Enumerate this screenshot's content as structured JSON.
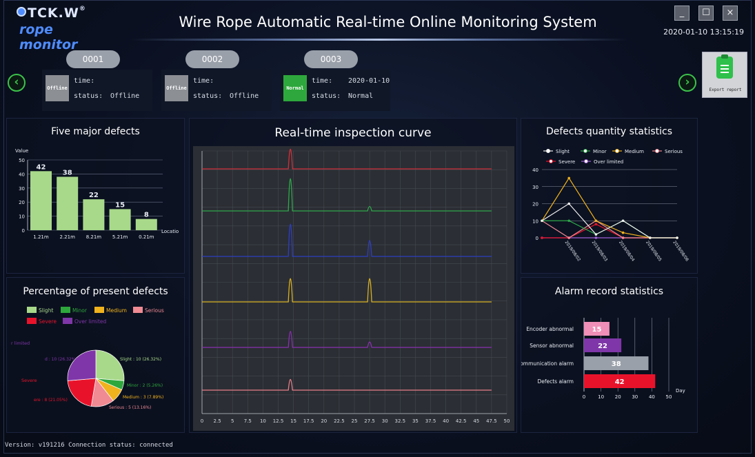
{
  "header": {
    "logo_brand": "TCK.W",
    "logo_sub": "rope monitor",
    "title": "Wire Rope Automatic Real-time Online Monitoring System",
    "datetime": "2020-01-10 13:15:19",
    "min_label": "_",
    "max_label": "☐",
    "close_label": "×"
  },
  "nav": {
    "prev": "‹",
    "next": "›"
  },
  "devices": [
    {
      "id": "0001",
      "status_box": "Offline",
      "status_color": "#8c8f94",
      "time_label": "time:",
      "time_value": "",
      "status_label": "status:",
      "status_value": "Offline"
    },
    {
      "id": "0002",
      "status_box": "Offline",
      "status_color": "#8c8f94",
      "time_label": "time:",
      "time_value": "",
      "status_label": "status:",
      "status_value": "Offline"
    },
    {
      "id": "0003",
      "status_box": "Normal",
      "status_color": "#2ea83c",
      "time_label": "time:",
      "time_value": "2020-01-10",
      "status_label": "status:",
      "status_value": "Normal"
    }
  ],
  "export_label": "Export report",
  "status_bar": "Version: v191216 Connection status: connected",
  "chart_data": [
    {
      "type": "bar",
      "title": "Five major defects",
      "ylabel": "Value",
      "xlabel": "Locatio",
      "categories": [
        "1.21m",
        "2.21m",
        "8.21m",
        "5.21m",
        "0.21m"
      ],
      "values": [
        42,
        38,
        22,
        15,
        8
      ],
      "ylim": [
        0,
        50
      ],
      "yticks": [
        0,
        10,
        20,
        30,
        40,
        50
      ],
      "color": "#a8d98a"
    },
    {
      "type": "pie",
      "title": "Percentage of present defects",
      "legend": [
        {
          "name": "Slight",
          "color": "#a8d98a"
        },
        {
          "name": "Minor",
          "color": "#2ea83c"
        },
        {
          "name": "Medium",
          "color": "#f0b21d"
        },
        {
          "name": "Serious",
          "color": "#f08a93"
        },
        {
          "name": "Severe",
          "color": "#e8132b"
        },
        {
          "name": "Over limited",
          "color": "#7f36a8"
        }
      ],
      "slices": [
        {
          "name": "Slight",
          "value": 10,
          "label": "Slight : 10 (26.32%)"
        },
        {
          "name": "Minor",
          "value": 2,
          "label": "Minor : 2 (5.26%)"
        },
        {
          "name": "Medium",
          "value": 3,
          "label": "Medium : 3 (7.89%)"
        },
        {
          "name": "Serious",
          "value": 5,
          "label": "Serious : 5 (13.16%)"
        },
        {
          "name": "Severe",
          "value": 8,
          "label": "ere : 8 (21.05%)"
        },
        {
          "name": "Over limited",
          "value": 10,
          "label": "d : 10 (26.32%)"
        }
      ],
      "cropped_labels": {
        "over_limited": "r limited",
        "severe": "Severe"
      }
    },
    {
      "type": "line",
      "title": "Real-time inspection curve",
      "xlim": [
        0,
        50
      ],
      "xticks": [
        0,
        2.5,
        5,
        7.5,
        10,
        12.5,
        15,
        17.5,
        20,
        22.5,
        25,
        27.5,
        30,
        32.5,
        35,
        37.5,
        40,
        42.5,
        45,
        47.5,
        50
      ],
      "series": [
        {
          "color": "#d0303a",
          "peaks": [
            {
              "x": 14.5,
              "h": 22
            }
          ]
        },
        {
          "color": "#2ea84a",
          "peaks": [
            {
              "x": 14.5,
              "h": 36
            },
            {
              "x": 27.5,
              "h": 5
            }
          ]
        },
        {
          "color": "#2e3ec2",
          "peaks": [
            {
              "x": 14.5,
              "h": 36
            },
            {
              "x": 27.5,
              "h": 18
            }
          ]
        },
        {
          "color": "#d8b020",
          "peaks": [
            {
              "x": 14.5,
              "h": 26
            },
            {
              "x": 27.5,
              "h": 26
            }
          ]
        },
        {
          "color": "#8a2fb0",
          "peaks": [
            {
              "x": 14.5,
              "h": 18
            },
            {
              "x": 27.5,
              "h": 6
            }
          ]
        },
        {
          "color": "#e87f8a",
          "peaks": [
            {
              "x": 14.5,
              "h": 12
            }
          ]
        }
      ]
    },
    {
      "type": "line",
      "title": "Defects quantity statistics",
      "categories": [
        "2019/08/02",
        "2019/08/03",
        "2019/08/04",
        "2019/08/05",
        "2019/08/06"
      ],
      "ylim": [
        0,
        40
      ],
      "yticks": [
        0,
        10,
        20,
        30,
        40
      ],
      "series": [
        {
          "name": "Slight",
          "color": "#f0f0f0",
          "values": [
            10,
            20,
            2,
            10,
            0,
            0
          ]
        },
        {
          "name": "Minor",
          "color": "#2ea84a",
          "values": [
            10,
            10,
            2,
            10,
            0,
            0
          ]
        },
        {
          "name": "Medium",
          "color": "#f0b21d",
          "values": [
            10,
            35,
            10,
            3,
            0,
            0
          ]
        },
        {
          "name": "Serious",
          "color": "#f08a93",
          "values": [
            10,
            0,
            10,
            0,
            0,
            0
          ]
        },
        {
          "name": "Severe",
          "color": "#e8132b",
          "values": [
            0,
            0,
            8,
            0,
            0,
            0
          ]
        },
        {
          "name": "Over limited",
          "color": "#a060d8",
          "values": [
            0,
            0,
            0,
            0,
            0,
            0
          ]
        }
      ]
    },
    {
      "type": "bar",
      "orientation": "horizontal",
      "title": "Alarm record statistics",
      "xlabel": "Day",
      "categories": [
        "Encoder abnormal",
        "Sensor abnormal",
        "Communication alarm",
        "Defects alarm"
      ],
      "values": [
        15,
        22,
        38,
        42
      ],
      "colors": [
        "#f08fb8",
        "#7f36a8",
        "#9aa0aa",
        "#e8132b"
      ],
      "xlim": [
        0,
        50
      ],
      "xticks": [
        0,
        10,
        20,
        30,
        40,
        50
      ]
    }
  ]
}
